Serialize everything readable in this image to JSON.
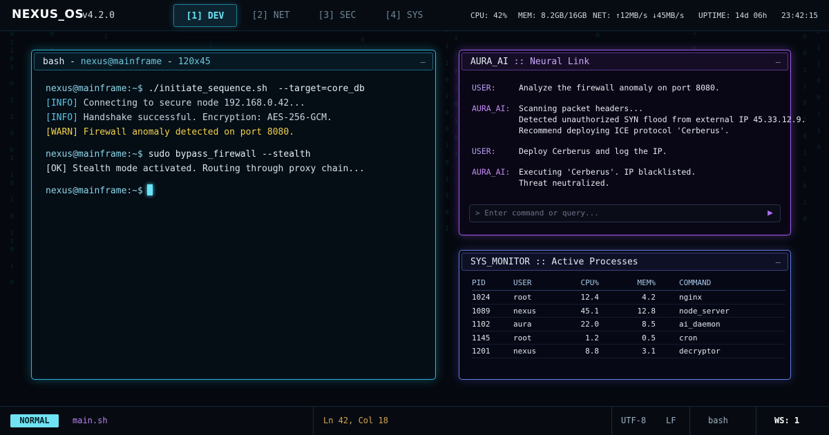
{
  "topbar": {
    "brand": "NEXUS_OS",
    "version": "v4.2.0",
    "tabs": [
      {
        "label": "[1] DEV"
      },
      {
        "label": "[2] NET"
      },
      {
        "label": "[3] SEC"
      },
      {
        "label": "[4] SYS"
      }
    ],
    "stats": {
      "cpu": "CPU: 42%",
      "mem": "MEM: 8.2GB/16GB",
      "net": "NET: ↑12MB/s ↓45MB/s",
      "uptime": "UPTIME: 14d 06h",
      "clock": "23:42:15"
    }
  },
  "terminal": {
    "title": "bash",
    "sep1": "-",
    "host": "nexus@mainframe",
    "sep2": "-",
    "size": "120x45",
    "control": "—",
    "prompt": "nexus@mainframe:~$",
    "cmd1": "./initiate_sequence.sh  --target=core_db",
    "out1_tag": "[INFO]",
    "out1_text": "Connecting to secure node 192.168.0.42...",
    "out2_tag": "[INFO]",
    "out2_text": "Handshake successful. Encryption: AES-256-GCM.",
    "out3": "[WARN] Firewall anomaly detected on port 8080.",
    "cmd2": "sudo bypass_firewall --stealth",
    "out4_tag": "[OK]",
    "out4_text": "Stealth mode activated. Routing through proxy chain..."
  },
  "ai": {
    "title": "AURA_AI",
    "subtitle": ":: Neural Link",
    "control": "—",
    "messages": [
      {
        "who": "USER:",
        "text": "Analyze the firewall anomaly on port 8080."
      },
      {
        "who": "AURA_AI:",
        "text": "Scanning packet headers...\nDetected unauthorized SYN flood from external IP 45.33.12.9.\nRecommend deploying ICE protocol 'Cerberus'."
      },
      {
        "who": "USER:",
        "text": "Deploy Cerberus and log the IP."
      },
      {
        "who": "AURA_AI:",
        "text": "Executing 'Cerberus'. IP blacklisted.\nThreat neutralized."
      }
    ],
    "input_prompt": ">",
    "input_placeholder": "Enter command or query...",
    "send_icon": "▶"
  },
  "monitor": {
    "title": "SYS_MONITOR",
    "subtitle": ":: Active Processes",
    "control": "—",
    "headers": {
      "pid": "PID",
      "user": "USER",
      "cpu": "CPU%",
      "mem": "MEM%",
      "cmd": "COMMAND"
    },
    "rows": [
      {
        "pid": "1024",
        "user": "root",
        "cpu": "12.4",
        "mem": "4.2",
        "cmd": "nginx"
      },
      {
        "pid": "1089",
        "user": "nexus",
        "cpu": "45.1",
        "mem": "12.8",
        "cmd": "node_server"
      },
      {
        "pid": "1102",
        "user": "aura",
        "cpu": "22.0",
        "mem": "8.5",
        "cmd": "ai_daemon"
      },
      {
        "pid": "1145",
        "user": "root",
        "cpu": "1.2",
        "mem": "0.5",
        "cmd": "cron"
      },
      {
        "pid": "1201",
        "user": "nexus",
        "cpu": "8.8",
        "mem": "3.1",
        "cmd": "decryptor"
      }
    ]
  },
  "statusbar": {
    "mode": "NORMAL",
    "file": "main.sh",
    "position": "Ln 42, Col 18",
    "encoding": "UTF-8",
    "eol": "LF",
    "language": "bash",
    "workspace": "WS: 1"
  },
  "colors": {
    "accent_cyan": "#2fb6d3",
    "accent_purple": "#a45cf0",
    "warn": "#f0d24a",
    "background": "#05090f"
  }
}
